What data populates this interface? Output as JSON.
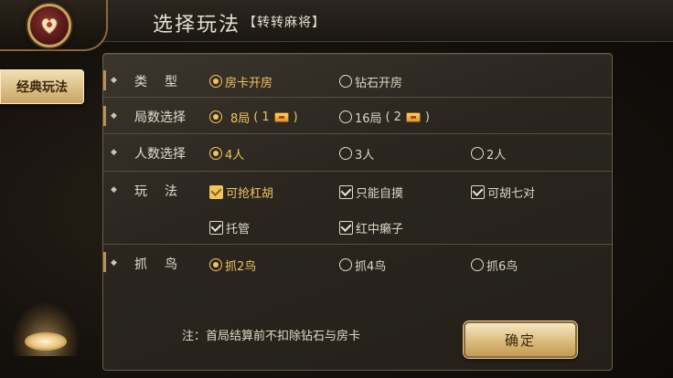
{
  "header": {
    "title": "选择玩法",
    "subtitle": "【转转麻将】"
  },
  "side_tabs": [
    {
      "label": "经典玩法",
      "selected": true
    }
  ],
  "rows": {
    "type": {
      "label": "类型",
      "options": [
        {
          "label": "房卡开房",
          "selected": true
        },
        {
          "label": "钻石开房",
          "selected": false
        }
      ]
    },
    "rounds": {
      "label": "局数选择",
      "options": [
        {
          "label": "8局",
          "cost": "1",
          "selected": true
        },
        {
          "label": "16局",
          "cost": "2",
          "selected": false
        }
      ]
    },
    "players": {
      "label": "人数选择",
      "options": [
        {
          "label": "4人",
          "selected": true
        },
        {
          "label": "3人",
          "selected": false
        },
        {
          "label": "2人",
          "selected": false
        }
      ]
    },
    "rules": {
      "label": "玩法",
      "options": [
        {
          "label": "可抢杠胡",
          "checked": true
        },
        {
          "label": "只能自摸",
          "checked": true
        },
        {
          "label": "可胡七对",
          "checked": true
        },
        {
          "label": "托管",
          "checked": true
        },
        {
          "label": "红中癞子",
          "checked": true
        }
      ]
    },
    "birds": {
      "label": "抓鸟",
      "options": [
        {
          "label": "抓2鸟",
          "selected": true
        },
        {
          "label": "抓4鸟",
          "selected": false
        },
        {
          "label": "抓6鸟",
          "selected": false
        }
      ]
    }
  },
  "note": "注：首局结算前不扣除钻石与房卡",
  "confirm_label": "确定",
  "colors": {
    "accent_gold": "#f0c45a",
    "panel_bg": "#2a251f",
    "button_gold": "#d9b877"
  }
}
